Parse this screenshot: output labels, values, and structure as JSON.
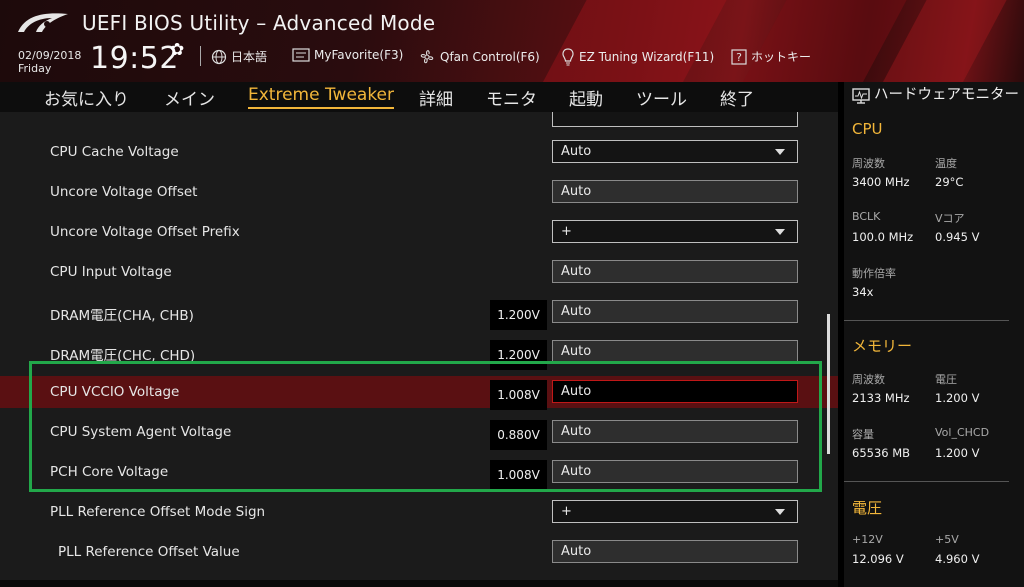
{
  "app": {
    "title": "UEFI BIOS Utility – Advanced Mode"
  },
  "datetime": {
    "date": "02/09/2018",
    "weekday": "Friday",
    "time": "19:52"
  },
  "toolbar": [
    {
      "id": "language",
      "icon": "globe-icon",
      "label": "日本語"
    },
    {
      "id": "myfavorite",
      "icon": "favorite-icon",
      "label": "MyFavorite(F3)"
    },
    {
      "id": "qfan",
      "icon": "fan-icon",
      "label": "Qfan Control(F6)"
    },
    {
      "id": "eztuning",
      "icon": "bulb-icon",
      "label": "EZ Tuning Wizard(F11)"
    },
    {
      "id": "hotkeys",
      "icon": "help-icon",
      "label": "ホットキー"
    }
  ],
  "menu": {
    "items": [
      "お気に入り",
      "メイン",
      "Extreme Tweaker",
      "詳細",
      "モニタ",
      "起動",
      "ツール",
      "終了"
    ],
    "active": "Extreme Tweaker"
  },
  "settings": [
    {
      "label": "CPU Cache Voltage",
      "value": "Auto",
      "type": "select"
    },
    {
      "label": "Uncore Voltage Offset",
      "value": "Auto",
      "type": "text"
    },
    {
      "label": "Uncore Voltage Offset Prefix",
      "value": "+",
      "type": "select"
    },
    {
      "label": "CPU Input Voltage",
      "value": "Auto",
      "type": "text"
    },
    {
      "label": "DRAM電圧(CHA, CHB)",
      "reading": "1.200V",
      "value": "Auto",
      "type": "text"
    },
    {
      "label": "DRAM電圧(CHC, CHD)",
      "reading": "1.200V",
      "value": "Auto",
      "type": "text"
    },
    {
      "label": "CPU VCCIO Voltage",
      "reading": "1.008V",
      "value": "Auto",
      "type": "text",
      "selected": true
    },
    {
      "label": "CPU System Agent Voltage",
      "reading": "0.880V",
      "value": "Auto",
      "type": "text"
    },
    {
      "label": "PCH Core Voltage",
      "reading": "1.008V",
      "value": "Auto",
      "type": "text"
    },
    {
      "label": "PLL Reference Offset Mode Sign",
      "value": "+",
      "type": "select"
    },
    {
      "label": "PLL Reference Offset Value",
      "value": "Auto",
      "type": "text",
      "indent": true
    }
  ],
  "monitor": {
    "title": "ハードウェアモニター",
    "cpu": {
      "title": "CPU",
      "freq_label": "周波数",
      "freq": "3400 MHz",
      "temp_label": "温度",
      "temp": "29°C",
      "bclk_label": "BCLK",
      "bclk": "100.0 MHz",
      "vcore_label": "Vコア",
      "vcore": "0.945 V",
      "ratio_label": "動作倍率",
      "ratio": "34x"
    },
    "memory": {
      "title": "メモリー",
      "freq_label": "周波数",
      "freq": "2133 MHz",
      "volt_label": "電圧",
      "volt": "1.200 V",
      "cap_label": "容量",
      "cap": "65536 MB",
      "vol_chcd_label": "Vol_CHCD",
      "vol_chcd": "1.200 V"
    },
    "voltage": {
      "title": "電圧",
      "v12_label": "+12V",
      "v12": "12.096 V",
      "v5_label": "+5V",
      "v5": "4.960 V"
    }
  },
  "colors": {
    "accent": "#f2b63a",
    "selected_row": "#5a1012",
    "highlight": "#22a84a"
  }
}
